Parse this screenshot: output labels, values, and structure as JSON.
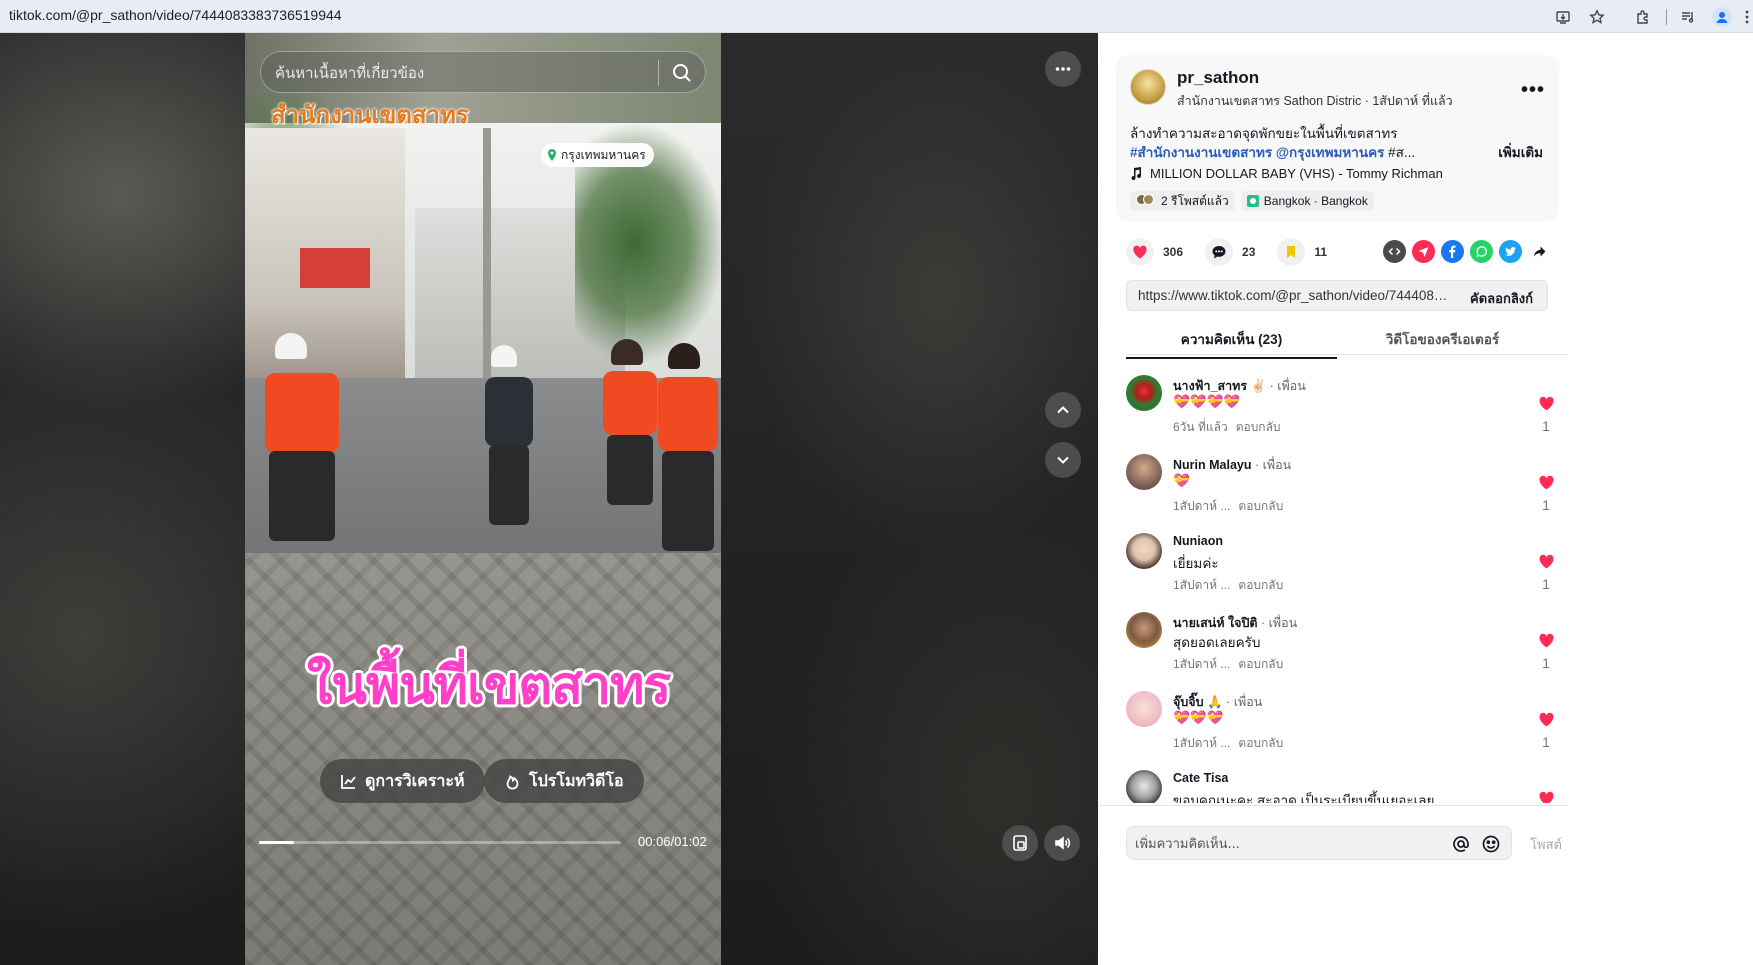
{
  "browser": {
    "url": "tiktok.com/@pr_sathon/video/7444083383736519944"
  },
  "player": {
    "search_placeholder": "ค้นหาเนื้อหาที่เกี่ยวข้อง",
    "overlay_title": "สำนักงานเขตสาทร",
    "location_chip": "กรุงเทพมหานคร",
    "overlay_caption": "ในพื้นที่เขตสาทร",
    "analytics_button": "ดูการวิเคราะห์",
    "promote_button": "โปรโมทวิดีโอ",
    "time": "00:06/01:02",
    "progress_fraction": 0.097
  },
  "post": {
    "author": "pr_sathon",
    "author_sub": "สำนักงานเขตสาทร Sathon Distric · 1สัปดาห์ ที่แล้ว",
    "desc_line1": "ล้างทำความสะอาดจุดพักขยะในพื้นที่เขตสาทร",
    "tag1": "#สำนักงานงานเขตสาทร",
    "tag2": "@กรุงเทพมหานคร",
    "tag3": "#ส...",
    "see_more": "เพิ่มเติม",
    "music": "MILLION DOLLAR BABY (VHS) - Tommy Richman",
    "repost_chip": "2 รีโพสต์แล้ว",
    "location_chip": "Bangkok · Bangkok"
  },
  "actions": {
    "likes": "306",
    "comments": "23",
    "saves": "11"
  },
  "share_colors": {
    "embed": "#4a4a4a",
    "send": "#fe2c55",
    "facebook": "#1877f2",
    "whatsapp": "#25d366",
    "twitter": "#1da1f2"
  },
  "link": {
    "url": "https://www.tiktok.com/@pr_sathon/video/7444083...",
    "copy_label": "คัดลอกลิงก์"
  },
  "tabs": {
    "comments": "ความคิดเห็น (23)",
    "creator_videos": "วิดีโอของครีเอเตอร์"
  },
  "comments": [
    {
      "name": "นางฟ้า_สาทร",
      "emoji_badge": "✌🏻",
      "friend": " · เพื่อน",
      "text": "💝💝💝💝",
      "time": "6วัน ที่แล้ว",
      "reply": "ตอบกลับ",
      "likes": "1",
      "avatar_color": "#2e7d32"
    },
    {
      "name": "Nurin Malayu",
      "emoji_badge": "",
      "friend": " · เพื่อน",
      "text": "💝",
      "time": "1สัปดาห์ ...",
      "reply": "ตอบกลับ",
      "likes": "1",
      "avatar_color": "#8d6e63"
    },
    {
      "name": "Nuniaon",
      "emoji_badge": "",
      "friend": "",
      "text": "เยี่ยมค่ะ",
      "time": "1สัปดาห์ ...",
      "reply": "ตอบกลับ",
      "likes": "1",
      "avatar_color": "#d7ccc8"
    },
    {
      "name": "นายเสน่ห์ ใจปิติ",
      "emoji_badge": "",
      "friend": " · เพื่อน",
      "text": "สุดยอดเลยครับ",
      "time": "1สัปดาห์ ...",
      "reply": "ตอบกลับ",
      "likes": "1",
      "avatar_color": "#a1887f"
    },
    {
      "name": "จุ๊บจิ๊บ",
      "emoji_badge": "🙏",
      "friend": " · เพื่อน",
      "text": "💝💝💝",
      "time": "1สัปดาห์ ...",
      "reply": "ตอบกลับ",
      "likes": "1",
      "avatar_color": "#f8bbd0"
    },
    {
      "name": "Cate Tisa",
      "emoji_badge": "",
      "friend": "",
      "text": "ขอบคุณนะคะ สะอาด เป็นระเบียบขึ้นเยอะเลย",
      "time": "",
      "reply": "",
      "likes": "",
      "avatar_color": "#9e9e9e"
    }
  ],
  "composer": {
    "placeholder": "เพิ่มความคิดเห็น...",
    "post_label": "โพสต์"
  }
}
